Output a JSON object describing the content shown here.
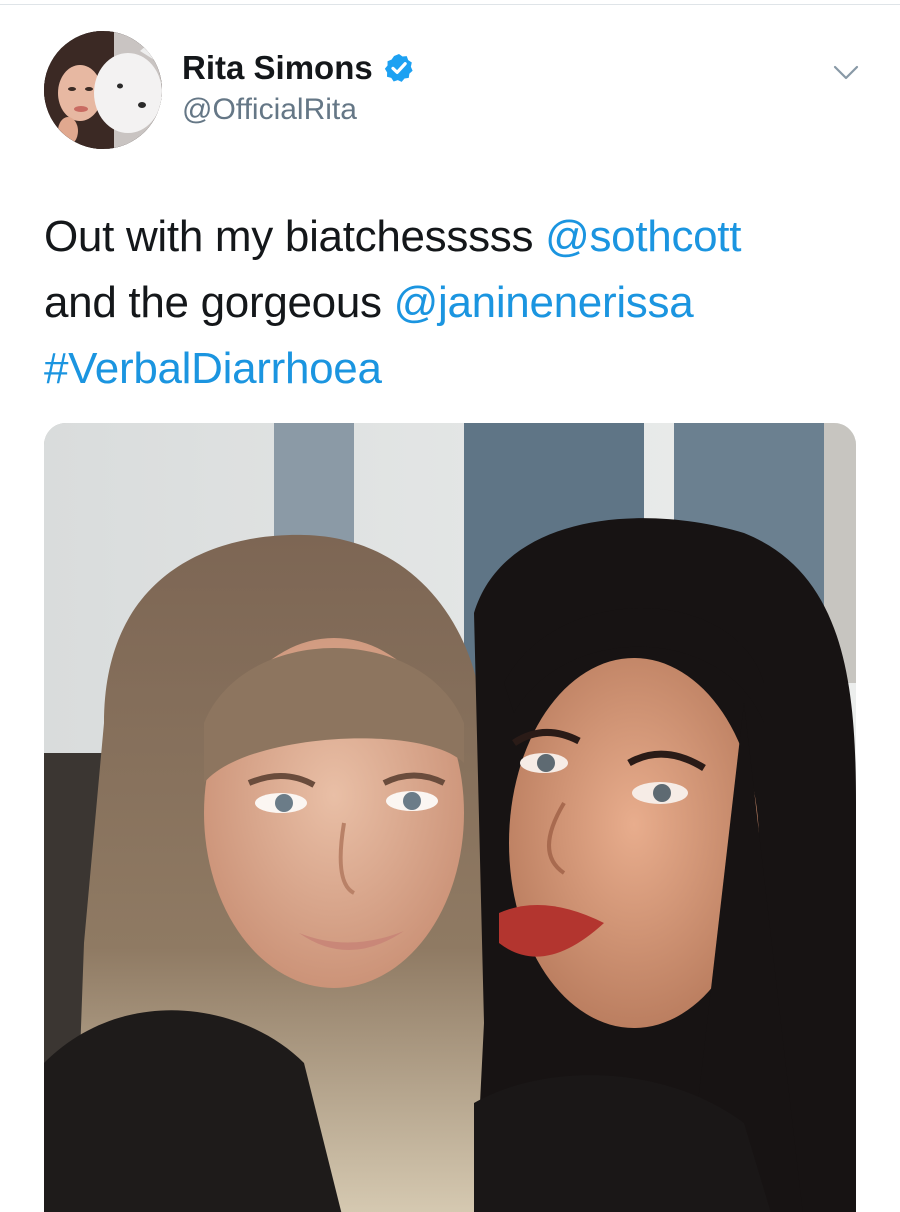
{
  "tweet": {
    "author": {
      "display_name": "Rita Simons",
      "handle": "@OfficialRita",
      "verified": true,
      "avatar_icon": "profile-photo-avatar"
    },
    "menu_icon": "chevron-down-icon",
    "text": {
      "line1_text": "Out with my biatchesssss ",
      "line1_mention": "@sothcott",
      "line2_text": "and the gorgeous ",
      "line2_mention": "@janinenerissa",
      "line3_hashtag": "#VerbalDiarrhoea"
    },
    "media": {
      "type": "photo",
      "icon": "selfie-photo"
    }
  },
  "colors": {
    "link": "#1b95e0",
    "text": "#14171a",
    "secondary_text": "#657786",
    "verified_badge": "#1da1f2",
    "divider": "#dfe4e8"
  }
}
